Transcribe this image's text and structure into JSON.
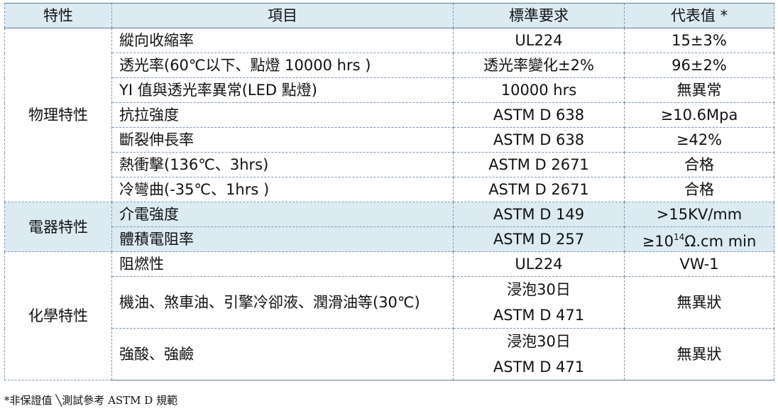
{
  "header": {
    "col1": "特性",
    "col2": "項目",
    "col3": "標準要求",
    "col4": "代表值 *"
  },
  "groups": {
    "physical": "物理特性",
    "electrical": "電器特性",
    "chemical": "化學特性"
  },
  "rows": [
    {
      "item": "縱向收縮率",
      "standard": "UL224",
      "value": "15±3%"
    },
    {
      "item": "透光率(60℃以下、點燈 10000 hrs )",
      "standard": "透光率變化±2%",
      "value": "96±2%"
    },
    {
      "item": "YI 值與透光率異常(LED 點燈)",
      "standard": "10000 hrs",
      "value": "無異常"
    },
    {
      "item": "抗拉強度",
      "standard": "ASTM D 638",
      "value": "≥10.6Mpa"
    },
    {
      "item": "斷裂伸長率",
      "standard": "ASTM D 638",
      "value": "≥42%"
    },
    {
      "item": "熱衝擊(136℃、3hrs)",
      "standard": "ASTM D 2671",
      "value": "合格"
    },
    {
      "item": "冷彎曲(-35℃、1hrs )",
      "standard": "ASTM D 2671",
      "value": "合格"
    },
    {
      "item": "介電強度",
      "standard": "ASTM D 149",
      "value": ">15KV/mm"
    },
    {
      "item": "體積電阻率",
      "standard": "ASTM D 257",
      "value_main": "≥10",
      "value_sup": "14",
      "value_tail": "Ω.cm min"
    },
    {
      "item": "阻燃性",
      "standard": "UL224",
      "value": "VW-1"
    },
    {
      "item": "機油、煞車油、引擎冷卻液、潤滑油等(30℃)",
      "standard_line1": "浸泡30日",
      "standard_line2": "ASTM D 471",
      "value": "無異狀"
    },
    {
      "item": "強酸、強鹼",
      "standard_line1": "浸泡30日",
      "standard_line2": "ASTM D 471",
      "value": "無異狀"
    }
  ],
  "footnote": "*非保證值 ╲測試參考 ASTM D 規範"
}
